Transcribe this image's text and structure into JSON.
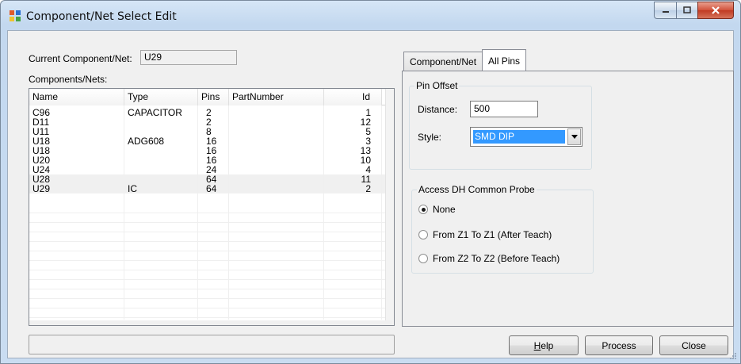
{
  "window": {
    "title": "Component/Net Select Edit"
  },
  "current": {
    "label": "Current Component/Net:",
    "value": "U29"
  },
  "list": {
    "label": "Components/Nets:",
    "columns": [
      "Name",
      "Type",
      "Pins",
      "PartNumber",
      "Id"
    ],
    "rows": [
      {
        "name": "C96",
        "type": "CAPACITOR",
        "pins": "2",
        "part": "",
        "id": "1"
      },
      {
        "name": "D11",
        "type": "",
        "pins": "2",
        "part": "",
        "id": "12"
      },
      {
        "name": "U11",
        "type": "",
        "pins": "8",
        "part": "",
        "id": "5"
      },
      {
        "name": "U18",
        "type": "ADG608",
        "pins": "16",
        "part": "",
        "id": "3"
      },
      {
        "name": "U18",
        "type": "",
        "pins": "16",
        "part": "",
        "id": "13"
      },
      {
        "name": "U20",
        "type": "",
        "pins": "16",
        "part": "",
        "id": "10"
      },
      {
        "name": "U24",
        "type": "",
        "pins": "24",
        "part": "",
        "id": "4"
      },
      {
        "name": "U28",
        "type": "",
        "pins": "64",
        "part": "",
        "id": "11"
      },
      {
        "name": "U29",
        "type": "IC",
        "pins": "64",
        "part": "",
        "id": "2"
      }
    ]
  },
  "tabs": [
    {
      "label": "Component/Net",
      "active": false
    },
    {
      "label": "All Pins",
      "active": true
    }
  ],
  "pin_offset": {
    "title": "Pin Offset",
    "distance_label": "Distance:",
    "distance_value": "500",
    "style_label": "Style:",
    "style_value": "SMD DIP"
  },
  "probe": {
    "title": "Access DH Common Probe",
    "options": [
      {
        "label": "None",
        "checked": true
      },
      {
        "label": "From Z1 To Z1 (After Teach)",
        "checked": false
      },
      {
        "label": "From Z2 To Z2 (Before Teach)",
        "checked": false
      }
    ]
  },
  "buttons": {
    "help_prefix": "",
    "help_mnemonic": "H",
    "help_rest": "elp",
    "process": "Process",
    "close": "Close"
  }
}
